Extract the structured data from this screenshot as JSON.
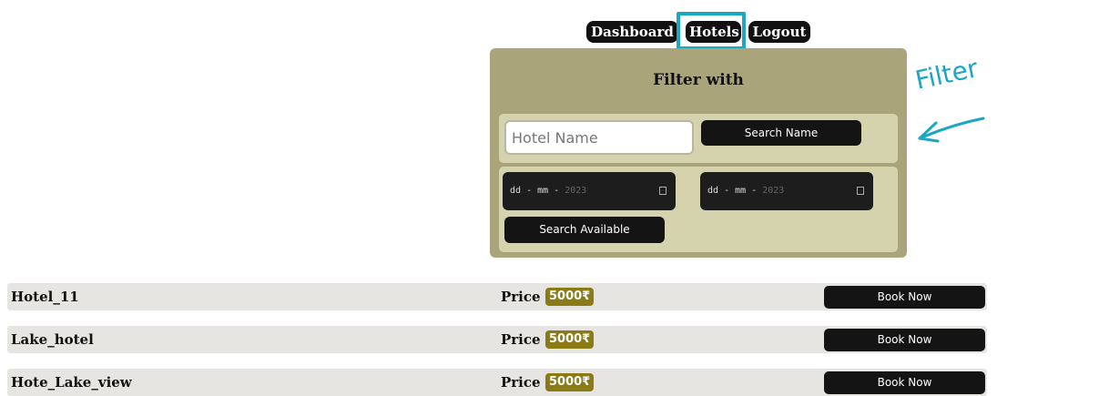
{
  "nav": {
    "items": [
      {
        "label": "Dashboard"
      },
      {
        "label": "Hotels"
      },
      {
        "label": "Logout"
      }
    ]
  },
  "filter": {
    "title": "Filter with",
    "name_placeholder": "Hotel Name",
    "search_name_label": "Search Name",
    "date_from": {
      "dd": "dd",
      "mm": "mm",
      "yyyy": "2023"
    },
    "date_to": {
      "dd": "dd",
      "mm": "mm",
      "yyyy": "2023"
    },
    "search_available_label": "Search Available"
  },
  "annotation": {
    "text": "Filter"
  },
  "hotels": [
    {
      "name": "Hotel_11",
      "price_label": "Price",
      "price": "5000₹",
      "book_label": "Book Now"
    },
    {
      "name": "Lake_hotel",
      "price_label": "Price",
      "price": "5000₹",
      "book_label": "Book Now"
    },
    {
      "name": "Hote_Lake_view",
      "price_label": "Price",
      "price": "5000₹",
      "book_label": "Book Now"
    }
  ],
  "colors": {
    "panel": "#a9a47a",
    "panel_row": "#d5d3ad",
    "highlight": "#1aa7c2",
    "price_badge": "#8b7b16"
  }
}
